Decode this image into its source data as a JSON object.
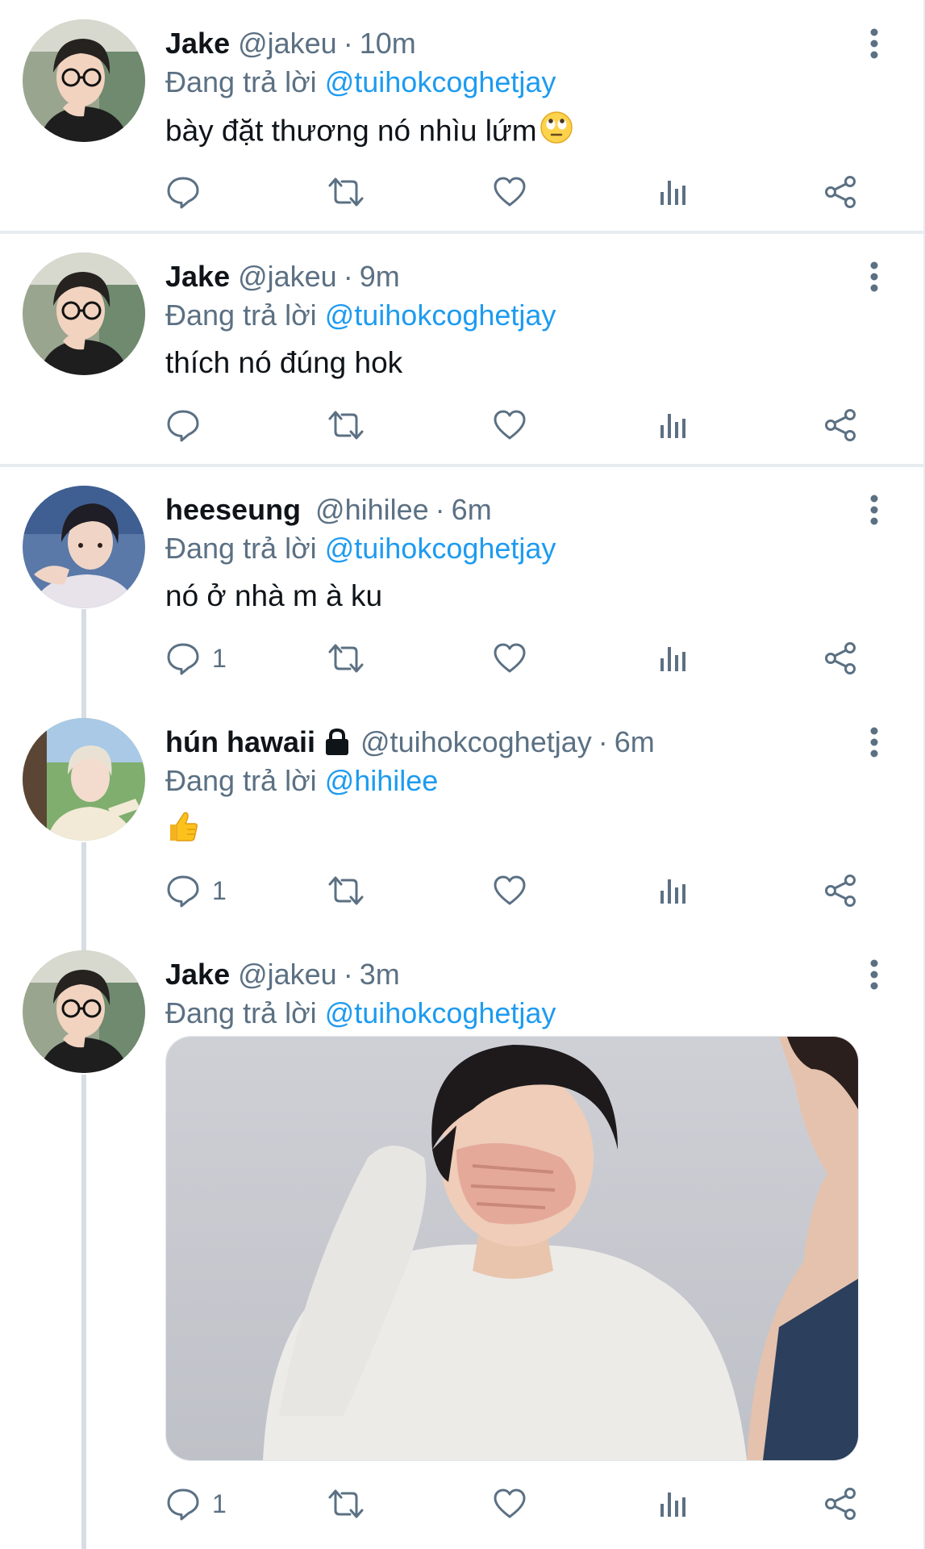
{
  "tweets": [
    {
      "name": "Jake",
      "handle": "@jakeu",
      "dot": "·",
      "time": "10m",
      "reply_prefix": "Đang trả lời",
      "reply_to": "@tuihokcoghetjay",
      "text": "bày đặt thương nó nhìu lứm",
      "text_emoji": "face-with-rolling-eyes-emoji",
      "reply_count": "",
      "avatar": "jake-avatar"
    },
    {
      "name": "Jake",
      "handle": "@jakeu",
      "dot": "·",
      "time": "9m",
      "reply_prefix": "Đang trả lời",
      "reply_to": "@tuihokcoghetjay",
      "text": "thích nó đúng hok",
      "reply_count": "",
      "avatar": "jake-avatar"
    },
    {
      "name": "heeseung",
      "handle": "@hihilee",
      "dot": "·",
      "time": "6m",
      "reply_prefix": "Đang trả lời",
      "reply_to": "@tuihokcoghetjay",
      "text": "nó ở nhà m à ku",
      "reply_count": "1",
      "avatar": "heeseung-avatar"
    },
    {
      "name": "hún hawaii",
      "locked": true,
      "handle": "@tuihokcoghetjay",
      "dot": "·",
      "time": "6m",
      "reply_prefix": "Đang trả lời",
      "reply_to": "@hihilee",
      "text_emoji": "thumbs-up-emoji",
      "reply_count": "1",
      "avatar": "hun-hawaii-avatar"
    },
    {
      "name": "Jake",
      "handle": "@jakeu",
      "dot": "·",
      "time": "3m",
      "reply_prefix": "Đang trả lời",
      "reply_to": "@tuihokcoghetjay",
      "media": "photo-person-covering-mouth",
      "reply_count": "1",
      "avatar": "jake-avatar"
    }
  ],
  "icons": {
    "reply": "reply-icon",
    "retweet": "retweet-icon",
    "like": "heart-icon",
    "views": "views-icon",
    "share": "share-icon",
    "more": "more-vertical-icon",
    "lock": "lock-icon"
  },
  "colors": {
    "text": "#0f1419",
    "secondary": "#5b7083",
    "mention": "#1d9bf0",
    "separator": "#e6ecf0",
    "thread_line": "#d6dde3"
  }
}
